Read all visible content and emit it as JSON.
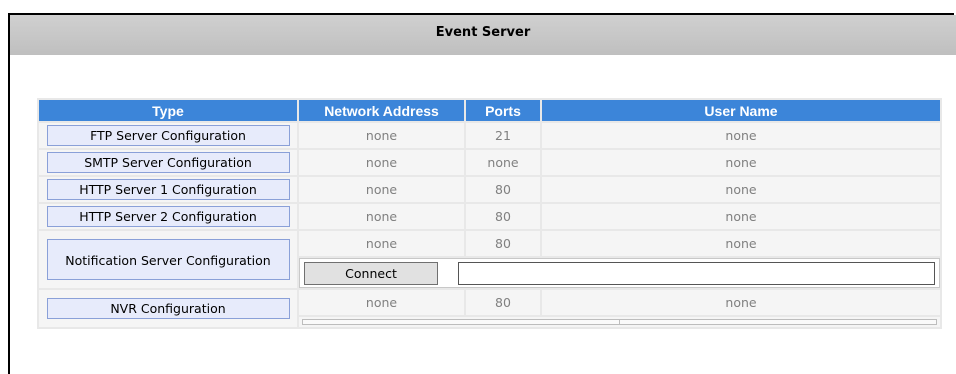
{
  "header": {
    "title": "Event Server"
  },
  "table": {
    "columns": [
      "Type",
      "Network Address",
      "Ports",
      "User Name"
    ],
    "rows": [
      {
        "type": "FTP Server Configuration",
        "address": "none",
        "port": "21",
        "user": "none"
      },
      {
        "type": "SMTP Server Configuration",
        "address": "none",
        "port": "none",
        "user": "none"
      },
      {
        "type": "HTTP Server 1 Configuration",
        "address": "none",
        "port": "80",
        "user": "none"
      },
      {
        "type": "HTTP Server 2 Configuration",
        "address": "none",
        "port": "80",
        "user": "none"
      },
      {
        "type": "Notification Server Configuration",
        "address": "none",
        "port": "80",
        "user": "none"
      },
      {
        "type": "NVR Configuration",
        "address": "none",
        "port": "80",
        "user": "none"
      }
    ]
  },
  "notification": {
    "connect_label": "Connect",
    "input_value": ""
  }
}
